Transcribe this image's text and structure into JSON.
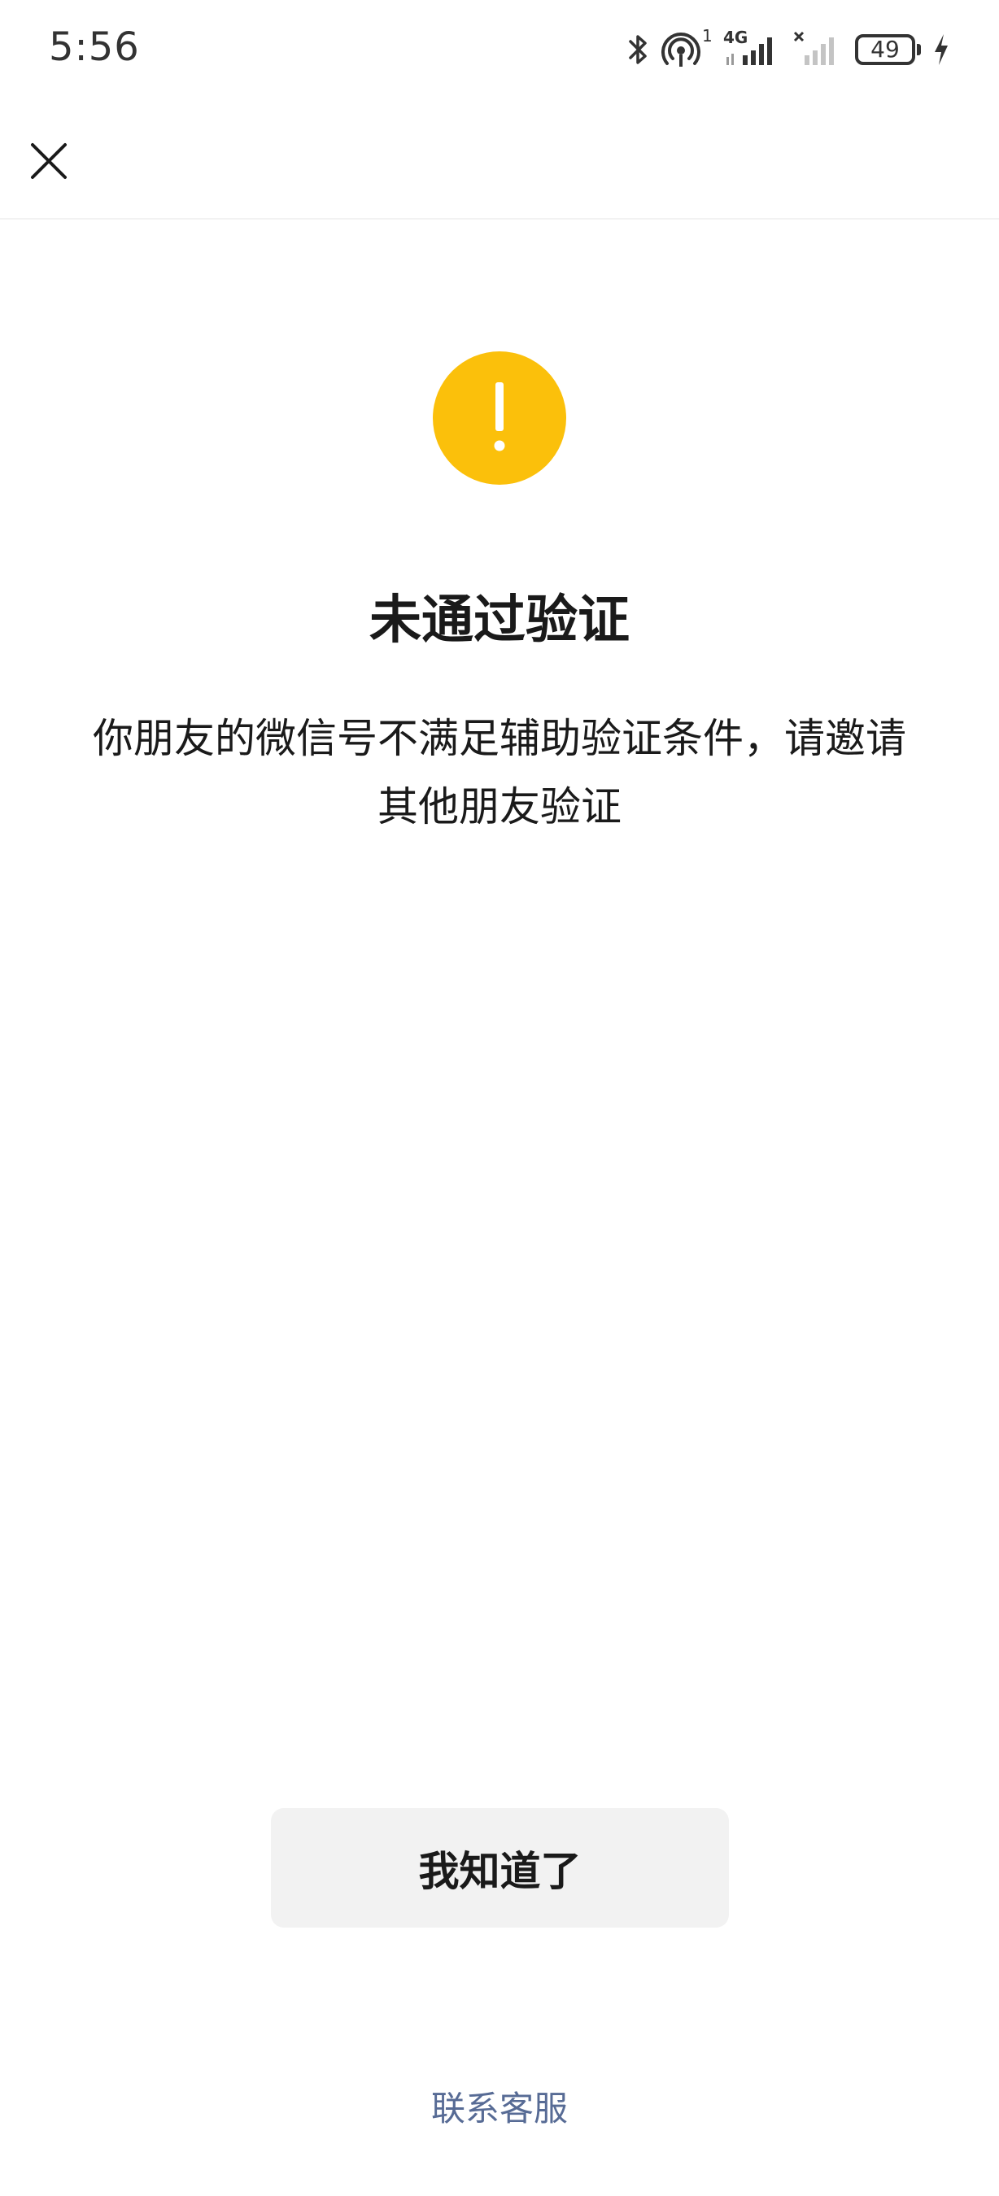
{
  "status_bar": {
    "time": "5:56",
    "battery_level": "49",
    "hotspot_count": "1",
    "network_type": "4G",
    "icons": [
      "bluetooth-icon",
      "hotspot-icon",
      "signal-icon",
      "no-sim-signal-icon",
      "battery-icon",
      "charging-icon"
    ]
  },
  "nav": {
    "close_icon": "close-icon"
  },
  "main": {
    "icon": "warning-icon",
    "icon_color": "#fbc00b",
    "title": "未通过验证",
    "description": "你朋友的微信号不满足辅助验证条件，请邀请其他朋友验证"
  },
  "actions": {
    "acknowledge_label": "我知道了",
    "contact_label": "联系客服",
    "link_color": "#576b95"
  }
}
